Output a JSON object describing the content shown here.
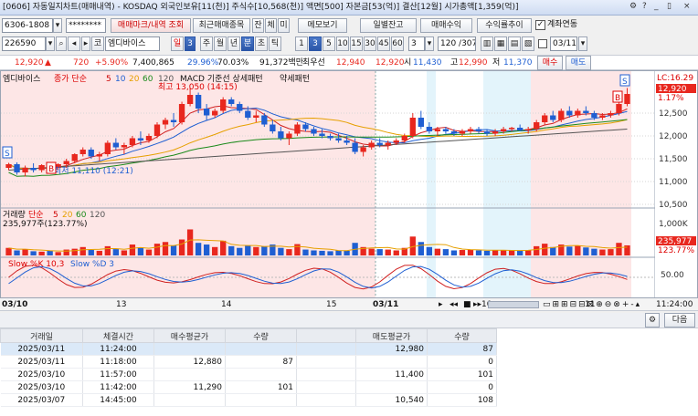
{
  "window": {
    "title": "[0606] 자동일지차트(매매내역) - KOSDAQ 외국인보유[11(천)] 주식수[10,568(천)] 액면[500] 자본금[53(억)] 결산[12월] 시가총액[1,359(억)]",
    "controls": [
      "?",
      "_",
      "▯",
      "×"
    ]
  },
  "toolbar1": {
    "account": "6306-1808",
    "password": "********",
    "tab_trade_mark": "매매마크/내역 조회",
    "tab_recent": "최근매매종목",
    "btn_jan": "잔",
    "btn_che": "체",
    "btn_mi": "미",
    "btn_memo": "메모보기",
    "btn_daily_balance": "일별잔고",
    "btn_trade_profit": "매매수익",
    "btn_profit_trend": "수익률추이",
    "chk_account_link": "계좌연동"
  },
  "toolbar2": {
    "code": "226590",
    "stock_prefix": "코",
    "stock_name": "엠디바이스",
    "period_day": "일",
    "period_num": "3",
    "periods": [
      "주",
      "월",
      "년",
      "분",
      "초",
      "틱"
    ],
    "minutes": [
      "1",
      "3",
      "5",
      "10",
      "15",
      "30",
      "45",
      "60"
    ],
    "min_sel": "3",
    "count": "120 /307",
    "date": "03/11"
  },
  "quote": {
    "price": "12,920",
    "arrow": "▲",
    "change": "720",
    "change_pct": "+5.90%",
    "volume": "7,400,865",
    "turnover_pct": "29.96%",
    "strength": "70.03%",
    "amount": "91,372백만",
    "label_best": "최우선",
    "best_ask": "12,940",
    "best_bid": "12,920",
    "label_open": "시",
    "open": "11,430",
    "label_high": "고",
    "high": "12,990",
    "label_low": "저",
    "low": "11,370",
    "btn_buy": "매수",
    "btn_sell": "매도"
  },
  "chart_data": {
    "type": "candlestick",
    "price_panel": {
      "legend": [
        "엠디바이스",
        "종가 단순",
        "5",
        "10",
        "20",
        "60",
        "120",
        "MACD 기준선 상세패턴",
        "약세패턴"
      ],
      "annotations": {
        "high_label": "최고 13,050 (14:15)",
        "low_label": "최저 11,110 (12:21)"
      },
      "ylim": [
        10500,
        13300
      ],
      "yticks": [
        "12,500",
        "12,000",
        "11,500",
        "11,000",
        "10,500"
      ],
      "last_label": "12,920",
      "lc_label": "LC:16.29",
      "pct_label": "1.17%",
      "ohlc": [
        [
          11300,
          11410,
          11250,
          11380
        ],
        [
          11380,
          11420,
          11150,
          11200
        ],
        [
          11200,
          11350,
          11110,
          11300
        ],
        [
          11300,
          11400,
          11200,
          11250
        ],
        [
          11250,
          11380,
          11200,
          11360
        ],
        [
          11360,
          11420,
          11250,
          11300
        ],
        [
          11300,
          11400,
          11250,
          11380
        ],
        [
          11380,
          11500,
          11300,
          11450
        ],
        [
          11450,
          11620,
          11400,
          11600
        ],
        [
          11600,
          11750,
          11550,
          11700
        ],
        [
          11700,
          11750,
          11500,
          11550
        ],
        [
          11550,
          11650,
          11450,
          11600
        ],
        [
          11600,
          11900,
          11550,
          11850
        ],
        [
          11850,
          11950,
          11700,
          11750
        ],
        [
          11750,
          11850,
          11600,
          11800
        ],
        [
          11800,
          12000,
          11750,
          11950
        ],
        [
          11950,
          12100,
          11800,
          11900
        ],
        [
          11900,
          12050,
          11850,
          12000
        ],
        [
          12000,
          12300,
          11950,
          12250
        ],
        [
          12250,
          12400,
          12150,
          12350
        ],
        [
          12350,
          12500,
          12200,
          12300
        ],
        [
          12300,
          12750,
          12250,
          12700
        ],
        [
          12700,
          13050,
          12650,
          12900
        ],
        [
          12900,
          12950,
          12500,
          12600
        ],
        [
          12600,
          12700,
          12350,
          12450
        ],
        [
          12450,
          12600,
          12400,
          12550
        ],
        [
          12550,
          12850,
          12500,
          12800
        ],
        [
          12800,
          12850,
          12650,
          12700
        ],
        [
          12700,
          12750,
          12500,
          12550
        ],
        [
          12550,
          12650,
          12350,
          12400
        ],
        [
          12400,
          12550,
          12300,
          12450
        ],
        [
          12450,
          12500,
          12200,
          12250
        ],
        [
          12250,
          12350,
          12050,
          12100
        ],
        [
          12100,
          12200,
          11900,
          11950
        ],
        [
          11950,
          12100,
          11800,
          12050
        ],
        [
          12050,
          12300,
          12000,
          12250
        ],
        [
          12250,
          12300,
          12100,
          12150
        ],
        [
          12150,
          12200,
          12000,
          12050
        ],
        [
          12050,
          12150,
          11950,
          12000
        ],
        [
          12000,
          12050,
          11900,
          11950
        ],
        [
          11950,
          12050,
          11850,
          11900
        ],
        [
          11900,
          12000,
          11800,
          11850
        ],
        [
          11850,
          11950,
          11600,
          11650
        ],
        [
          11650,
          11800,
          11550,
          11750
        ],
        [
          11750,
          11900,
          11700,
          11850
        ],
        [
          11850,
          11950,
          11750,
          11800
        ],
        [
          11800,
          11900,
          11700,
          11850
        ],
        [
          11850,
          11950,
          11800,
          11900
        ],
        [
          11900,
          12050,
          11850,
          12000
        ],
        [
          12000,
          12500,
          11950,
          12400
        ],
        [
          12400,
          12550,
          12150,
          12200
        ],
        [
          12200,
          12300,
          12050,
          12100
        ],
        [
          12100,
          12200,
          12000,
          12150
        ],
        [
          12150,
          12200,
          12050,
          12100
        ],
        [
          12100,
          12150,
          12000,
          12050
        ],
        [
          12050,
          12150,
          12000,
          12100
        ],
        [
          12100,
          12200,
          12050,
          12150
        ],
        [
          12150,
          12200,
          12050,
          12100
        ],
        [
          12100,
          12150,
          12000,
          12050
        ],
        [
          12050,
          12150,
          12000,
          12100
        ],
        [
          12100,
          12200,
          12050,
          12150
        ],
        [
          12150,
          12200,
          12100,
          12180
        ],
        [
          12180,
          12250,
          12100,
          12120
        ],
        [
          12120,
          12200,
          12050,
          12150
        ],
        [
          12150,
          12350,
          12100,
          12300
        ],
        [
          12300,
          12500,
          12250,
          12450
        ],
        [
          12450,
          12550,
          12300,
          12350
        ],
        [
          12350,
          12600,
          12300,
          12550
        ],
        [
          12550,
          12650,
          12400,
          12450
        ],
        [
          12450,
          12600,
          12400,
          12550
        ],
        [
          12550,
          12650,
          12450,
          12500
        ],
        [
          12500,
          12550,
          12350,
          12400
        ],
        [
          12400,
          12500,
          12350,
          12450
        ],
        [
          12450,
          12550,
          12400,
          12500
        ],
        [
          12500,
          12750,
          12450,
          12700
        ],
        [
          12700,
          13050,
          12650,
          12920
        ]
      ],
      "sell_marker_label": "S",
      "buy_marker_label": "B"
    },
    "volume_panel": {
      "legend": [
        "거래량",
        "단순",
        "5",
        "20",
        "60",
        "120"
      ],
      "annotation": "235,977주(123.77%)",
      "yticks": [
        "1,000K",
        "500K"
      ],
      "last_label": "235,977",
      "pct_label": "123.77%",
      "volumes": [
        180,
        120,
        150,
        100,
        90,
        110,
        80,
        140,
        160,
        200,
        130,
        110,
        220,
        150,
        120,
        260,
        190,
        140,
        280,
        320,
        240,
        380,
        620,
        300,
        260,
        200,
        350,
        220,
        180,
        240,
        200,
        220,
        260,
        180,
        150,
        270,
        140,
        120,
        110,
        100,
        120,
        110,
        300,
        200,
        160,
        150,
        140,
        120,
        180,
        450,
        320,
        200,
        160,
        150,
        120,
        130,
        140,
        120,
        110,
        120,
        130,
        120,
        110,
        130,
        220,
        280,
        200,
        260,
        210,
        230,
        190,
        160,
        140,
        150,
        300,
        240
      ]
    },
    "stoch_panel": {
      "legend": [
        "Slow %K 10,3",
        "Slow %D 3"
      ],
      "yticks": [
        "50.00"
      ]
    },
    "x_labels": [
      "03/10",
      "13",
      "14",
      "15",
      "03/11",
      "10",
      "11"
    ],
    "time_label": "11:24:00"
  },
  "bottom_toolbar": {
    "btn_next": "다음"
  },
  "table": {
    "headers": [
      "거래일",
      "체결시간",
      "매수평균가",
      "수량",
      "",
      "매도평균가",
      "수량"
    ],
    "rows": [
      [
        "2025/03/11",
        "11:24:00",
        "",
        "",
        "",
        "12,980",
        "87"
      ],
      [
        "2025/03/11",
        "11:18:00",
        "12,880",
        "87",
        "",
        "",
        "0"
      ],
      [
        "2025/03/10",
        "11:57:00",
        "",
        "",
        "",
        "11,400",
        "101"
      ],
      [
        "2025/03/10",
        "11:42:00",
        "11,290",
        "101",
        "",
        "",
        "0"
      ],
      [
        "2025/03/07",
        "14:45:00",
        "",
        "",
        "",
        "10,540",
        "108"
      ]
    ]
  },
  "colors": {
    "up": "#e8271e",
    "down": "#1f5fd2",
    "highlight_pink": "#fde6e6",
    "highlight_cyan": "#e3f4fb"
  }
}
